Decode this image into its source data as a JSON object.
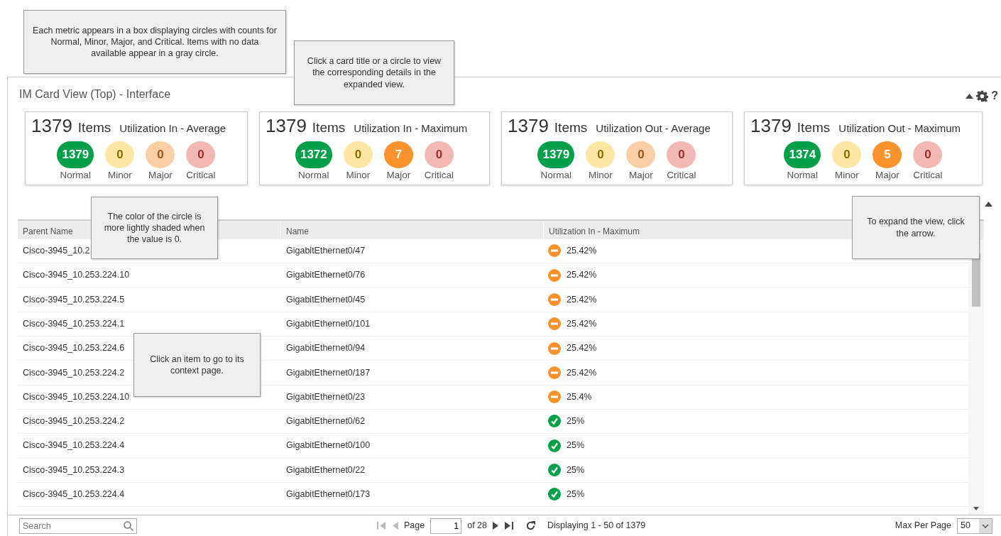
{
  "callouts": [
    "Each metric appears in a box displaying circles with counts for Normal, Minor, Major, and Critical. Items with no data available appear in a gray circle.",
    "Click a card title or a circle to view the corresponding details in the expanded view.",
    "The color of the circle is more lightly shaded when the value is 0.",
    "To expand the view, click the arrow.",
    "Click an item to go to its context page."
  ],
  "panel": {
    "title": "IM Card View (Top) - Interface",
    "help": "?"
  },
  "cards": [
    {
      "count": "1379",
      "unit": "Items",
      "title": "Utilization In - Average",
      "circles": [
        {
          "kind": "normal",
          "value": "1379",
          "label": "Normal",
          "dimmed": false
        },
        {
          "kind": "minor",
          "value": "0",
          "label": "Minor",
          "dimmed": true
        },
        {
          "kind": "major",
          "value": "0",
          "label": "Major",
          "dimmed": true
        },
        {
          "kind": "critical",
          "value": "0",
          "label": "Critical",
          "dimmed": true
        }
      ]
    },
    {
      "count": "1379",
      "unit": "Items",
      "title": "Utilization In - Maximum",
      "circles": [
        {
          "kind": "normal",
          "value": "1372",
          "label": "Normal",
          "dimmed": false
        },
        {
          "kind": "minor",
          "value": "0",
          "label": "Minor",
          "dimmed": true
        },
        {
          "kind": "major",
          "value": "7",
          "label": "Major",
          "dimmed": false
        },
        {
          "kind": "critical",
          "value": "0",
          "label": "Critical",
          "dimmed": true
        }
      ]
    },
    {
      "count": "1379",
      "unit": "Items",
      "title": "Utilization Out - Average",
      "circles": [
        {
          "kind": "normal",
          "value": "1379",
          "label": "Normal",
          "dimmed": false
        },
        {
          "kind": "minor",
          "value": "0",
          "label": "Minor",
          "dimmed": true
        },
        {
          "kind": "major",
          "value": "0",
          "label": "Major",
          "dimmed": true
        },
        {
          "kind": "critical",
          "value": "0",
          "label": "Critical",
          "dimmed": true
        }
      ]
    },
    {
      "count": "1379",
      "unit": "Items",
      "title": "Utilization Out - Maximum",
      "circles": [
        {
          "kind": "normal",
          "value": "1374",
          "label": "Normal",
          "dimmed": false
        },
        {
          "kind": "minor",
          "value": "0",
          "label": "Minor",
          "dimmed": true
        },
        {
          "kind": "major",
          "value": "5",
          "label": "Major",
          "dimmed": false
        },
        {
          "kind": "critical",
          "value": "0",
          "label": "Critical",
          "dimmed": true
        }
      ]
    }
  ],
  "table": {
    "columns": [
      "Parent Name",
      "Name",
      "Utilization In - Maximum"
    ],
    "rows": [
      {
        "parent": "Cisco-3945_10.2",
        "name": "GigabitEthernet0/47",
        "kind": "major",
        "color": "#f7922d",
        "value": "25.42%"
      },
      {
        "parent": "Cisco-3945_10.253.224.10",
        "name": "GigabitEthernet0/76",
        "kind": "major",
        "color": "#f7922d",
        "value": "25.42%"
      },
      {
        "parent": "Cisco-3945_10.253.224.5",
        "name": "GigabitEthernet0/45",
        "kind": "major",
        "color": "#f7922d",
        "value": "25.42%"
      },
      {
        "parent": "Cisco-3945_10.253.224.1",
        "name": "GigabitEthernet0/101",
        "kind": "major",
        "color": "#f7922d",
        "value": "25.42%"
      },
      {
        "parent": "Cisco-3945_10.253.224.6",
        "name": "GigabitEthernet0/94",
        "kind": "major",
        "color": "#f7922d",
        "value": "25.42%"
      },
      {
        "parent": "Cisco-3945_10.253.224.2",
        "name": "GigabitEthernet0/187",
        "kind": "major",
        "color": "#f7922d",
        "value": "25.42%"
      },
      {
        "parent": "Cisco-3945_10.253.224.10",
        "name": "GigabitEthernet0/23",
        "kind": "major",
        "color": "#f7922d",
        "value": "25.4%"
      },
      {
        "parent": "Cisco-3945_10.253.224.2",
        "name": "GigabitEthernet0/62",
        "kind": "normal",
        "color": "#00a04b",
        "value": "25%"
      },
      {
        "parent": "Cisco-3945_10.253.224.4",
        "name": "GigabitEthernet0/100",
        "kind": "normal",
        "color": "#00a04b",
        "value": "25%"
      },
      {
        "parent": "Cisco-3945_10.253.224.3",
        "name": "GigabitEthernet0/22",
        "kind": "normal",
        "color": "#00a04b",
        "value": "25%"
      },
      {
        "parent": "Cisco-3945_10.253.224.4",
        "name": "GigabitEthernet0/173",
        "kind": "normal",
        "color": "#00a04b",
        "value": "25%"
      }
    ]
  },
  "footer": {
    "search_placeholder": "Search",
    "page_label": "Page",
    "page": "1",
    "of_pages": "of 28",
    "displaying": "Displaying 1 - 50 of 1379",
    "max_label": "Max Per Page",
    "max_value": "50"
  }
}
